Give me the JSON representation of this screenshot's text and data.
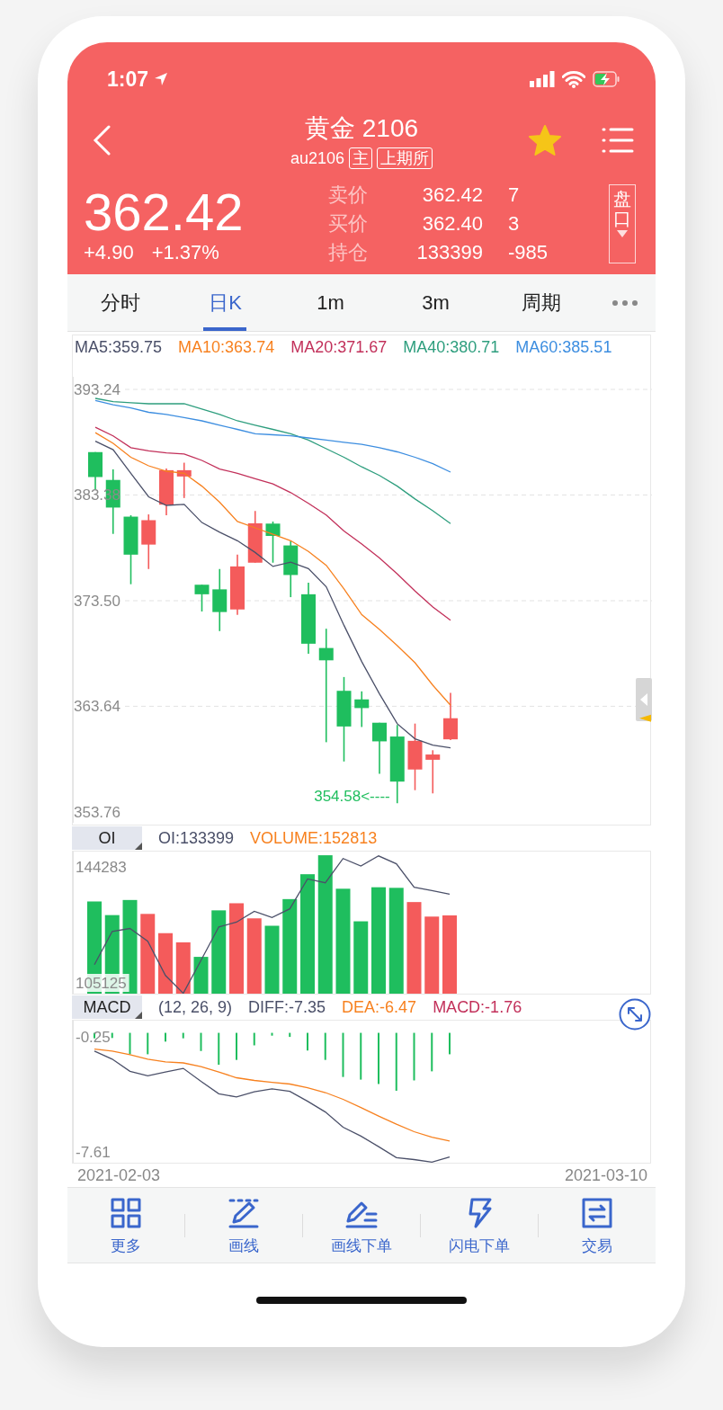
{
  "status_bar": {
    "time": "1:07"
  },
  "header": {
    "title": "黄金 2106",
    "symbol": "au2106",
    "tags": [
      "主",
      "上期所"
    ],
    "favorite": true,
    "price": "362.42",
    "change": "+4.90",
    "change_percent": "+1.37%",
    "depth_button": "盘口",
    "quotes": [
      {
        "label": "卖价",
        "value": "362.42",
        "qty": "7"
      },
      {
        "label": "买价",
        "value": "362.40",
        "qty": "3"
      },
      {
        "label": "持仓",
        "value": "133399",
        "qty": "-985"
      }
    ]
  },
  "tabs": [
    {
      "label": "分时",
      "selected": false
    },
    {
      "label": "日K",
      "selected": true
    },
    {
      "label": "1m",
      "selected": false
    },
    {
      "label": "3m",
      "selected": false
    },
    {
      "label": "周期",
      "selected": false
    }
  ],
  "main_chart": {
    "chart_data": {
      "type": "candlestick",
      "grid": true,
      "ylim": [
        353.76,
        393.24
      ],
      "yticks": [
        {
          "value": 393.24,
          "label": "393.24"
        },
        {
          "value": 383.38,
          "label": "383.38"
        },
        {
          "value": 373.5,
          "label": "373.50"
        },
        {
          "value": 363.64,
          "label": "363.64"
        },
        {
          "value": 353.76,
          "label": "353.76"
        }
      ],
      "ohlc": [
        [
          387.38,
          387.38,
          383.9,
          385.05
        ],
        [
          384.78,
          385.77,
          379.74,
          382.2
        ],
        [
          381.35,
          381.48,
          375.04,
          377.8
        ],
        [
          378.74,
          381.56,
          376.46,
          381.02
        ],
        [
          382.47,
          385.85,
          381.48,
          385.69
        ],
        [
          385.1,
          386.39,
          383.09,
          385.69
        ],
        [
          374.99,
          374.99,
          372.49,
          374.1
        ],
        [
          374.56,
          376.46,
          370.66,
          372.44
        ],
        [
          372.68,
          377.8,
          372.17,
          376.7
        ],
        [
          377.05,
          381.88,
          377.05,
          380.73
        ],
        [
          380.7,
          380.89,
          377.05,
          379.55
        ],
        [
          378.66,
          379.06,
          373.83,
          375.9
        ],
        [
          374.1,
          375.17,
          368.54,
          369.48
        ],
        [
          369.08,
          370.88,
          360.28,
          367.93
        ],
        [
          365.08,
          366.37,
          358.48,
          361.75
        ],
        [
          364.28,
          365.03,
          361.7,
          363.47
        ],
        [
          362.1,
          362.1,
          357.33,
          360.36
        ],
        [
          360.81,
          361.89,
          354.58,
          356.6
        ],
        [
          357.73,
          362.02,
          355.8,
          360.41
        ],
        [
          358.64,
          359.53,
          355.5,
          359.13
        ],
        [
          360.55,
          364.89,
          360.47,
          362.52
        ]
      ],
      "series": [
        {
          "name": "MA5:359.75",
          "type": "line",
          "color": "#4b5069",
          "values": [
            388.4,
            387.6,
            385.4,
            383.2,
            382.4,
            382.5,
            380.8,
            379.9,
            379.1,
            378.0,
            376.7,
            377.1,
            376.5,
            374.8,
            371.2,
            367.8,
            364.8,
            362.0,
            360.6,
            360.0,
            359.75
          ]
        },
        {
          "name": "MA10:363.74",
          "type": "line",
          "color": "#f7811f",
          "values": [
            389.2,
            388.2,
            386.9,
            386.1,
            385.6,
            385.4,
            384.2,
            382.7,
            380.9,
            380.3,
            379.7,
            379.1,
            378.1,
            376.8,
            374.6,
            372.2,
            370.8,
            369.3,
            367.7,
            365.6,
            363.74
          ]
        },
        {
          "name": "MA20:371.67",
          "type": "line",
          "color": "#c2305a",
          "values": [
            389.7,
            388.9,
            387.8,
            387.5,
            387.3,
            387.2,
            386.6,
            385.8,
            385.4,
            384.9,
            384.4,
            383.6,
            382.6,
            381.5,
            380.0,
            378.8,
            377.5,
            376.0,
            374.4,
            372.9,
            371.67
          ]
        },
        {
          "name": "MA40:380.71",
          "type": "line",
          "color": "#2e9e7e",
          "values": [
            392.4,
            392.1,
            392.0,
            391.9,
            391.9,
            391.9,
            391.4,
            390.9,
            390.3,
            389.9,
            389.5,
            389.1,
            388.5,
            387.7,
            386.9,
            386.0,
            385.2,
            384.2,
            383.0,
            381.9,
            380.71
          ]
        },
        {
          "name": "MA60:385.51",
          "type": "line",
          "color": "#3d8ee0",
          "values": [
            392.2,
            391.8,
            391.5,
            391.1,
            390.9,
            390.6,
            390.3,
            389.9,
            389.5,
            389.1,
            389.0,
            388.9,
            388.7,
            388.5,
            388.3,
            388.1,
            387.8,
            387.4,
            386.9,
            386.3,
            385.51
          ]
        }
      ],
      "annotations": [
        "354.58<----"
      ]
    }
  },
  "oi_panel": {
    "indicator": "OI",
    "chart_data": {
      "type": "bar",
      "ylim": [
        101482,
        149443
      ],
      "yticks": [
        {
          "value": 144283,
          "label": "144283"
        },
        {
          "value": 105125,
          "label": "105125"
        }
      ],
      "series": [
        {
          "name": "OI:133399",
          "type": "line",
          "color": "#4b5069",
          "values": [
            111300,
            122500,
            123500,
            119200,
            107600,
            101600,
            112700,
            124000,
            125600,
            129300,
            127200,
            130100,
            140200,
            138900,
            147100,
            144600,
            148000,
            145300,
            137400,
            136300,
            135100
          ]
        },
        {
          "name": "VOLUME:152813",
          "type": "bar",
          "color": "#f7811f",
          "values": [
            132600,
            128000,
            133100,
            128400,
            121900,
            118800,
            113900,
            129600,
            132000,
            126900,
            124400,
            133400,
            141800,
            148200,
            136900,
            125900,
            137400,
            137200,
            132400,
            127500,
            127900
          ],
          "colors": [
            "#1fbe5e",
            "#1fbe5e",
            "#1fbe5e",
            "#f45b5b",
            "#f45b5b",
            "#f45b5b",
            "#1fbe5e",
            "#1fbe5e",
            "#f45b5b",
            "#f45b5b",
            "#1fbe5e",
            "#1fbe5e",
            "#1fbe5e",
            "#1fbe5e",
            "#1fbe5e",
            "#1fbe5e",
            "#1fbe5e",
            "#1fbe5e",
            "#f45b5b",
            "#f45b5b",
            "#f45b5b"
          ]
        }
      ]
    }
  },
  "macd_panel": {
    "indicator": "MACD",
    "params": "(12, 26, 9)",
    "chart_data": {
      "type": "line",
      "ylim": [
        -8.3,
        0.78
      ],
      "yticks": [
        {
          "value": -0.25,
          "label": "-0.25"
        },
        {
          "value": -7.61,
          "label": "-7.61"
        }
      ],
      "series": [
        {
          "name": "DIFF:-7.35",
          "type": "line",
          "color": "#4b5069",
          "values": [
            -1.16,
            -1.68,
            -2.46,
            -2.75,
            -2.51,
            -2.27,
            -3.1,
            -3.89,
            -4.1,
            -3.77,
            -3.58,
            -3.74,
            -4.37,
            -5.06,
            -6.03,
            -6.6,
            -7.27,
            -7.98,
            -8.1,
            -8.26,
            -7.93
          ]
        },
        {
          "name": "DEA:-6.47",
          "type": "line",
          "color": "#f7811f",
          "values": [
            -1.04,
            -1.16,
            -1.4,
            -1.68,
            -1.85,
            -1.92,
            -2.16,
            -2.51,
            -2.87,
            -3.04,
            -3.16,
            -3.27,
            -3.51,
            -3.82,
            -4.25,
            -4.77,
            -5.32,
            -5.84,
            -6.32,
            -6.67,
            -6.91
          ]
        },
        {
          "name": "MACD:-1.76",
          "type": "bar",
          "color": "#c2305a",
          "values": [
            -0.35,
            -0.33,
            -1.37,
            -1.37,
            -0.56,
            -0.35,
            -1.16,
            -2.04,
            -1.73,
            -0.8,
            -0.18,
            -0.26,
            -1.13,
            -1.73,
            -2.82,
            -2.99,
            -3.27,
            -3.7,
            -3.04,
            -2.46,
            -1.37
          ],
          "colors": [
            "#1fbe5e",
            "#1fbe5e",
            "#1fbe5e",
            "#1fbe5e",
            "#1fbe5e",
            "#1fbe5e",
            "#1fbe5e",
            "#1fbe5e",
            "#1fbe5e",
            "#1fbe5e",
            "#1fbe5e",
            "#1fbe5e",
            "#1fbe5e",
            "#1fbe5e",
            "#1fbe5e",
            "#1fbe5e",
            "#1fbe5e",
            "#1fbe5e",
            "#1fbe5e",
            "#1fbe5e",
            "#1fbe5e"
          ]
        }
      ]
    }
  },
  "date_range": {
    "start": "2021-02-03",
    "end": "2021-03-10"
  },
  "toolbar": [
    {
      "kind": "grid",
      "label": "更多"
    },
    {
      "kind": "draw",
      "label": "画线"
    },
    {
      "kind": "draw-order",
      "label": "画线下单"
    },
    {
      "kind": "flash",
      "label": "闪电下单"
    },
    {
      "kind": "trade",
      "label": "交易"
    }
  ]
}
